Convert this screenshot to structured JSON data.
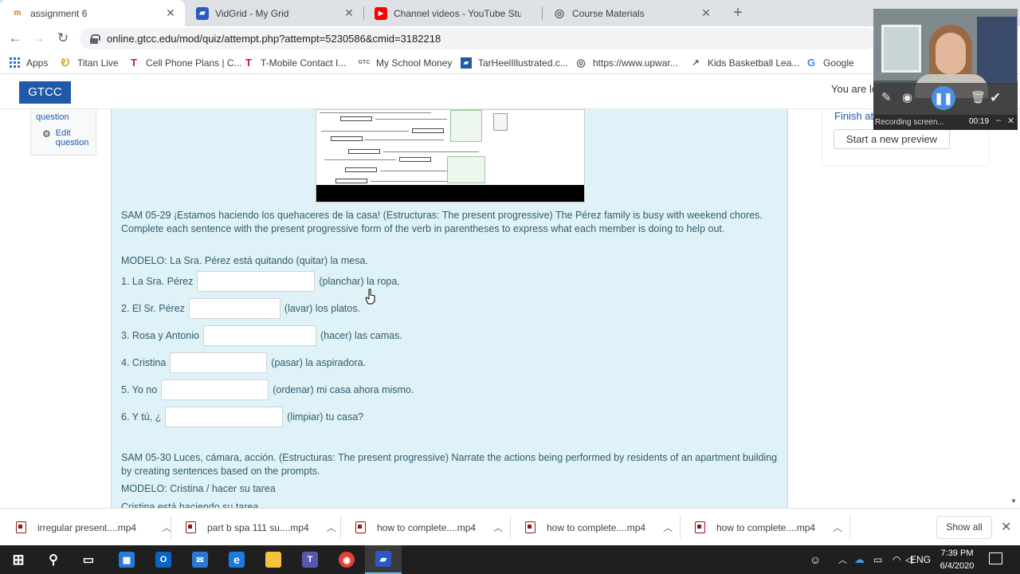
{
  "browser": {
    "tabs": [
      {
        "title": "assignment 6",
        "fav_color": "#e8710a",
        "fav_glyph": "m",
        "active": true
      },
      {
        "title": "VidGrid - My Grid",
        "fav_color": "#2b59c3",
        "fav_glyph": "▰",
        "active": false
      },
      {
        "title": "Channel videos - YouTube Studio",
        "fav_color": "#ff0000",
        "fav_glyph": "▶",
        "active": false
      },
      {
        "title": "Course Materials",
        "fav_color": "#5f6368",
        "fav_glyph": "◎",
        "active": false
      }
    ],
    "url": "online.gtcc.edu/mod/quiz/attempt.php?attempt=5230586&cmid=3182218",
    "bookmarks": [
      {
        "label": "Apps",
        "icon": "apps-grid-icon"
      },
      {
        "label": "Titan Live",
        "icon": "titan-icon"
      },
      {
        "label": "Cell Phone Plans | C...",
        "icon": "tmobile-icon"
      },
      {
        "label": "T-Mobile Contact I...",
        "icon": "tmobile-icon"
      },
      {
        "label": "My School Money",
        "icon": "gtcc-icon"
      },
      {
        "label": "TarHeelIllustrated.c...",
        "icon": "flag-icon"
      },
      {
        "label": "https://www.upwar...",
        "icon": "globe-icon"
      },
      {
        "label": "Kids Basketball Lea...",
        "icon": "chart-icon"
      },
      {
        "label": "Google",
        "icon": "google-icon"
      }
    ]
  },
  "site": {
    "brand": "GTCC",
    "logged_in": "You are logged in as Jennifer Ray"
  },
  "question_info": {
    "partial": "question",
    "edit": "Edit",
    "edit2": "question"
  },
  "question": {
    "prompt": "SAM 05-29 ¡Estamos haciendo los quehaceres de la casa! (Estructuras: The present progressive) The Pérez family is busy with weekend chores. Complete each sentence with the present progressive form of the verb in parentheses to express what each member is doing to help out.",
    "modelo": "MODELO: La Sra. Pérez está quitando (quitar) la mesa.",
    "items": [
      {
        "before": "1. La Sra. Pérez",
        "after": "(planchar) la ropa.",
        "value": ""
      },
      {
        "before": "2. El Sr. Pérez",
        "after": "(lavar) los platos.",
        "value": ""
      },
      {
        "before": "3. Rosa y Antonio",
        "after": "(hacer) las camas.",
        "value": ""
      },
      {
        "before": "4. Cristina",
        "after": "(pasar) la aspiradora.",
        "value": ""
      },
      {
        "before": "5. Yo no",
        "after": "(ordenar) mi casa ahora mismo.",
        "value": ""
      },
      {
        "before": "6. Y tú, ¿",
        "after": "(limpiar) tu casa?",
        "value": ""
      }
    ]
  },
  "question2": {
    "prompt": "SAM 05-30 Luces, cámara, acción. (Estructuras: The present progressive) Narrate the actions being performed by residents of an apartment building by creating sentences based on the prompts.",
    "modelo": "MODELO: Cristina / hacer su tarea",
    "example": "Cristina está haciendo su tarea."
  },
  "nav_block": {
    "finish": "Finish attempt ...",
    "start_preview": "Start a new preview"
  },
  "recorder": {
    "status": "Recording screen...",
    "time": "00:19"
  },
  "downloads": [
    {
      "name": "irregular present....mp4"
    },
    {
      "name": "part b spa 111 su....mp4"
    },
    {
      "name": "how to complete....mp4"
    },
    {
      "name": "how to complete....mp4"
    },
    {
      "name": "how to complete....mp4"
    }
  ],
  "downloads_show_all": "Show all",
  "taskbar": {
    "lang": "ENG",
    "time": "7:39 PM",
    "date": "6/4/2020",
    "apps": [
      {
        "name": "windows-start-icon",
        "color": "#ffffff",
        "glyph": "⊞"
      },
      {
        "name": "search-icon",
        "color": "#ffffff",
        "glyph": "⚲"
      },
      {
        "name": "task-view-icon",
        "color": "#ffffff",
        "glyph": "▭"
      },
      {
        "name": "store-icon",
        "color": "#2a7ad5",
        "glyph": "🛍"
      },
      {
        "name": "outlook-icon",
        "color": "#0a64c2",
        "glyph": "O"
      },
      {
        "name": "mail-icon",
        "color": "#2a7ad5",
        "glyph": "✉"
      },
      {
        "name": "edge-icon",
        "color": "#1f7adf",
        "glyph": "e"
      },
      {
        "name": "file-explorer-icon",
        "color": "#f3c340",
        "glyph": "▬"
      },
      {
        "name": "teams-icon",
        "color": "#5558af",
        "glyph": "T"
      },
      {
        "name": "chrome-icon",
        "color": "#e0443a",
        "glyph": "◉"
      },
      {
        "name": "vidgrid-icon",
        "color": "#2b59c3",
        "glyph": "▰"
      }
    ]
  }
}
